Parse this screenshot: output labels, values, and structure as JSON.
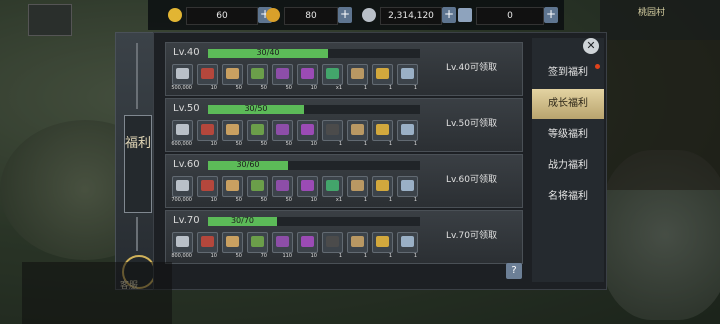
{
  "colors": {
    "accent_gold": "#d1b25a",
    "progress_green": "#5cbb58",
    "nav_active": "#e3d3a2",
    "plus_blue": "#5e7590",
    "red_dot": "#e0421b"
  },
  "topbar": {
    "resources": [
      {
        "icon": "gold-coin-icon",
        "value": "60"
      },
      {
        "icon": "gold-ingot-icon",
        "value": "80"
      },
      {
        "icon": "silver-coin-icon",
        "value": "2,314,120"
      },
      {
        "icon": "scroll-ticket-icon",
        "value": "0"
      }
    ],
    "plus_label": "+"
  },
  "minimap": {
    "location": "桃园村"
  },
  "left_tab": {
    "label": "福利"
  },
  "service": {
    "label": "客服"
  },
  "close_label": "✕",
  "help_label": "?",
  "nav": [
    {
      "label": "签到福利",
      "active": false,
      "dot": true
    },
    {
      "label": "成长福利",
      "active": true,
      "dot": false
    },
    {
      "label": "等级福利",
      "active": false,
      "dot": false
    },
    {
      "label": "战力福利",
      "active": false,
      "dot": false
    },
    {
      "label": "名将福利",
      "active": false,
      "dot": false
    }
  ],
  "rows": [
    {
      "level": "Lv.40",
      "progress": "30/40",
      "fill": 0.75,
      "claim": "Lv.40可领取"
    },
    {
      "level": "Lv.50",
      "progress": "30/50",
      "fill": 0.6,
      "claim": "Lv.50可领取"
    },
    {
      "level": "Lv.60",
      "progress": "30/60",
      "fill": 0.5,
      "claim": "Lv.60可领取"
    },
    {
      "level": "Lv.70",
      "progress": "30/70",
      "fill": 0.43,
      "claim": "Lv.70可领取"
    }
  ],
  "item_sets": [
    [
      {
        "icon": "silver-coin-icon",
        "color": "#b9c0c8",
        "count": "500,000"
      },
      {
        "icon": "red-book-icon",
        "color": "#b4473c",
        "count": "10"
      },
      {
        "icon": "scroll-icon",
        "color": "#c9a061",
        "count": "50"
      },
      {
        "icon": "jade-stack-icon",
        "color": "#6b9e4a",
        "count": "50"
      },
      {
        "icon": "purple-gem-icon",
        "color": "#8d4ea8",
        "count": "50"
      },
      {
        "icon": "purple-chest-icon",
        "color": "#9b4bb5",
        "count": "10"
      },
      {
        "icon": "green-orb-icon",
        "color": "#43a56b",
        "count": "x1"
      },
      {
        "icon": "treasure-box-icon",
        "color": "#b99863",
        "count": "1"
      },
      {
        "icon": "gold-token-icon",
        "color": "#d2a83d",
        "count": "1"
      },
      {
        "icon": "silver-box-icon",
        "color": "#9ab0c6",
        "count": "1"
      }
    ],
    [
      {
        "icon": "silver-coin-icon",
        "color": "#b9c0c8",
        "count": "600,000"
      },
      {
        "icon": "red-book-icon",
        "color": "#b4473c",
        "count": "10"
      },
      {
        "icon": "scroll-icon",
        "color": "#c9a061",
        "count": "50"
      },
      {
        "icon": "jade-stack-icon",
        "color": "#6b9e4a",
        "count": "50"
      },
      {
        "icon": "purple-gem-icon",
        "color": "#8d4ea8",
        "count": "50"
      },
      {
        "icon": "purple-chest-icon",
        "color": "#9b4bb5",
        "count": "10"
      },
      {
        "icon": "question-icon",
        "color": "#4b4b4b",
        "count": "1"
      },
      {
        "icon": "treasure-box-icon",
        "color": "#b99863",
        "count": "1"
      },
      {
        "icon": "gold-token-icon",
        "color": "#d2a83d",
        "count": "1"
      },
      {
        "icon": "silver-box-icon",
        "color": "#9ab0c6",
        "count": "1"
      }
    ],
    [
      {
        "icon": "silver-coin-icon",
        "color": "#b9c0c8",
        "count": "700,000"
      },
      {
        "icon": "red-book-icon",
        "color": "#b4473c",
        "count": "10"
      },
      {
        "icon": "scroll-icon",
        "color": "#c9a061",
        "count": "50"
      },
      {
        "icon": "jade-stack-icon",
        "color": "#6b9e4a",
        "count": "50"
      },
      {
        "icon": "purple-gem-icon",
        "color": "#8d4ea8",
        "count": "50"
      },
      {
        "icon": "purple-chest-icon",
        "color": "#9b4bb5",
        "count": "10"
      },
      {
        "icon": "green-orb-icon",
        "color": "#43a56b",
        "count": "x1"
      },
      {
        "icon": "treasure-box-icon",
        "color": "#b99863",
        "count": "1"
      },
      {
        "icon": "gold-token-icon",
        "color": "#d2a83d",
        "count": "1"
      },
      {
        "icon": "silver-box-icon",
        "color": "#9ab0c6",
        "count": "1"
      }
    ],
    [
      {
        "icon": "silver-coin-icon",
        "color": "#b9c0c8",
        "count": "800,000"
      },
      {
        "icon": "red-book-icon",
        "color": "#b4473c",
        "count": "10"
      },
      {
        "icon": "scroll-icon",
        "color": "#c9a061",
        "count": "50"
      },
      {
        "icon": "jade-stack-icon",
        "color": "#6b9e4a",
        "count": "70"
      },
      {
        "icon": "purple-gem-icon",
        "color": "#8d4ea8",
        "count": "110"
      },
      {
        "icon": "purple-chest-icon",
        "color": "#9b4bb5",
        "count": "10"
      },
      {
        "icon": "question-icon",
        "color": "#4b4b4b",
        "count": "1"
      },
      {
        "icon": "treasure-box-icon",
        "color": "#b99863",
        "count": "1"
      },
      {
        "icon": "gold-token-icon",
        "color": "#d2a83d",
        "count": "1"
      },
      {
        "icon": "silver-box-icon",
        "color": "#9ab0c6",
        "count": "1"
      }
    ]
  ]
}
